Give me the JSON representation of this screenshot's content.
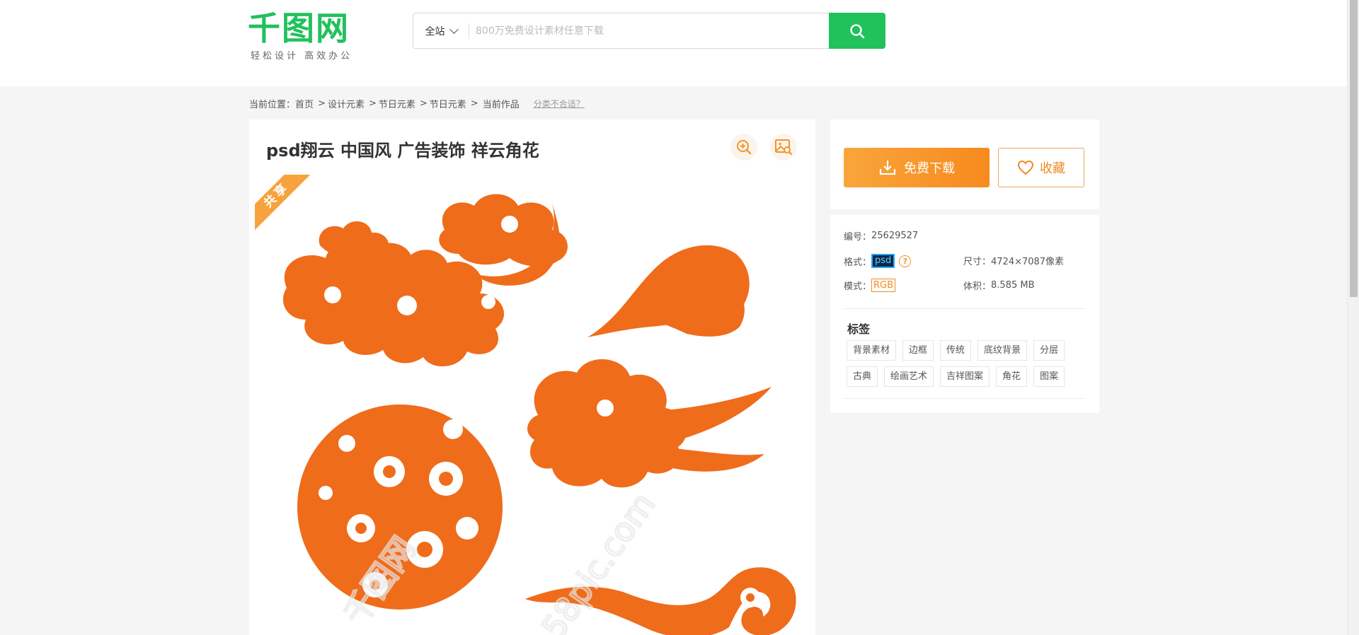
{
  "header": {
    "logo_text": "千图网",
    "logo_slogan": "轻松设计  高效办公",
    "search_scope": "全站",
    "search_placeholder": "800万免费设计素材任意下载",
    "brand_color": "#21c15c"
  },
  "breadcrumb": {
    "prefix": "当前位置：",
    "items": [
      {
        "label": "首页",
        "sep": ""
      },
      {
        "label": "设计元素",
        "sep": ">"
      },
      {
        "label": "节日元素",
        "sep": ">"
      },
      {
        "label": "节日元素",
        "sep": ">"
      },
      {
        "label": "当前作品",
        "sep": ">"
      }
    ],
    "help_link": "分类不合适？"
  },
  "work": {
    "title": "psd翔云 中国风 广告装饰 祥云角花",
    "ribbon_label": "共享",
    "tools": [
      {
        "icon": "zoom-in-icon"
      },
      {
        "icon": "image-search-icon"
      }
    ],
    "image_color": "#ef6c1b"
  },
  "actions": {
    "download_label": "免费下载",
    "favorite_label": "收藏",
    "accent_color": "#f78a1e"
  },
  "info": {
    "id_label": "编号：",
    "id_value": "25629527",
    "format_label": "格式：",
    "format_value": "psd",
    "size_label": "尺寸：",
    "size_value": "4724×7087像素",
    "mode_label": "模式：",
    "mode_value": "RGB",
    "volume_label": "体积：",
    "volume_value": "8.585 MB"
  },
  "tags": {
    "title": "标签",
    "row1": [
      "背景素材",
      "边框",
      "传统",
      "底纹背景",
      "分层"
    ],
    "row2": [
      "古典",
      "绘画艺术",
      "吉祥图案",
      "角花",
      "图案"
    ]
  }
}
